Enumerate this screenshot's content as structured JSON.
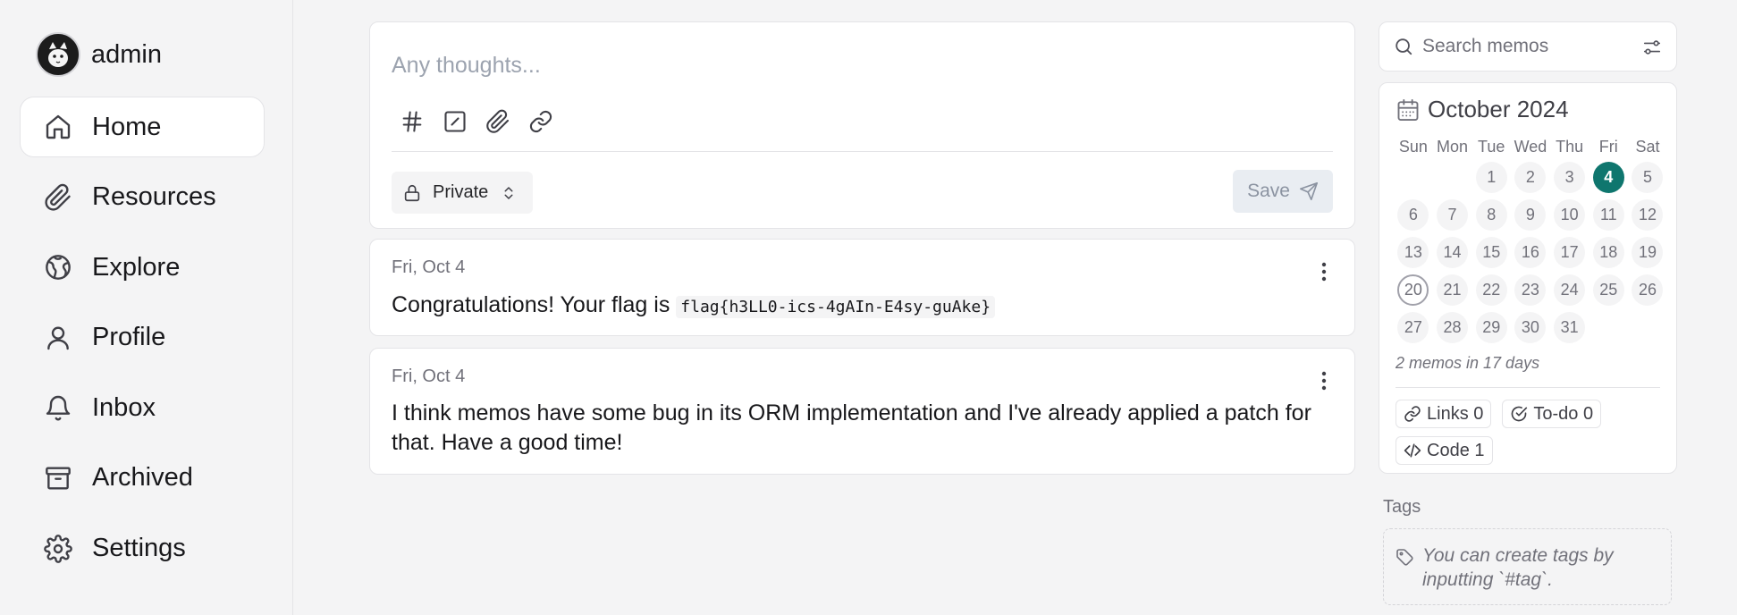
{
  "user": {
    "name": "admin"
  },
  "nav": [
    {
      "label": "Home",
      "icon": "home-icon",
      "active": true
    },
    {
      "label": "Resources",
      "icon": "paperclip-icon"
    },
    {
      "label": "Explore",
      "icon": "globe-icon"
    },
    {
      "label": "Profile",
      "icon": "user-icon"
    },
    {
      "label": "Inbox",
      "icon": "bell-icon"
    },
    {
      "label": "Archived",
      "icon": "archive-icon"
    },
    {
      "label": "Settings",
      "icon": "gear-icon"
    }
  ],
  "editor": {
    "placeholder": "Any thoughts...",
    "tools": [
      "hash-icon",
      "checkbox-icon",
      "paperclip-icon",
      "link-icon"
    ],
    "visibility": "Private",
    "save_label": "Save"
  },
  "memos": [
    {
      "date": "Fri, Oct 4",
      "text": "Congratulations! Your flag is ",
      "code": "flag{h3LL0-ics-4gAIn-E4sy-guAke}"
    },
    {
      "date": "Fri, Oct 4",
      "text": "I think memos have some bug in its ORM implementation and I've already applied a patch for that. Have a good time!"
    }
  ],
  "search": {
    "placeholder": "Search memos"
  },
  "calendar": {
    "title": "October 2024",
    "weekdays": [
      "Sun",
      "Mon",
      "Tue",
      "Wed",
      "Thu",
      "Fri",
      "Sat"
    ],
    "first_weekday_index": 2,
    "days_in_month": 31,
    "selected_day": 4,
    "today": 20,
    "summary": "2 memos in 17 days",
    "accent_color": "#0f766e"
  },
  "stats": {
    "links": "Links 0",
    "todo": "To-do 0",
    "code": "Code 1"
  },
  "tags": {
    "title": "Tags",
    "hint": "You can create tags by inputting `#tag`."
  }
}
